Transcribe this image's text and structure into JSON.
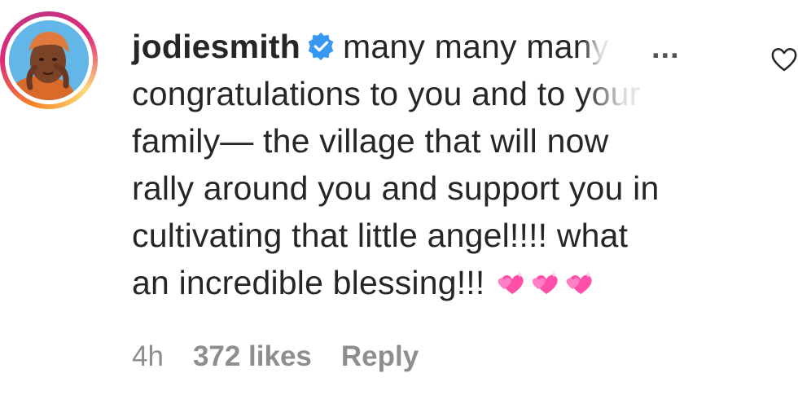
{
  "comment": {
    "username": "jodiesmith",
    "verified_icon": "verified-badge-icon",
    "body_lines": [
      "many many ma",
      "ny",
      "congratulations to you and to",
      " your",
      "family— the village that will now",
      "rally around you and support you in",
      "cultivating that little angel!!!! what",
      "an incredible blessing!!! "
    ],
    "emoji": [
      "sparkling-hearts-icon",
      "sparkling-hearts-icon",
      "sparkling-hearts-icon"
    ],
    "more_label": "...",
    "time": "4h",
    "likes": "372 likes",
    "reply_label": "Reply"
  },
  "colors": {
    "text": "#262626",
    "meta": "#8e8e8e",
    "verified": "#3897f0",
    "heart_emoji": "#ff4fa8"
  }
}
